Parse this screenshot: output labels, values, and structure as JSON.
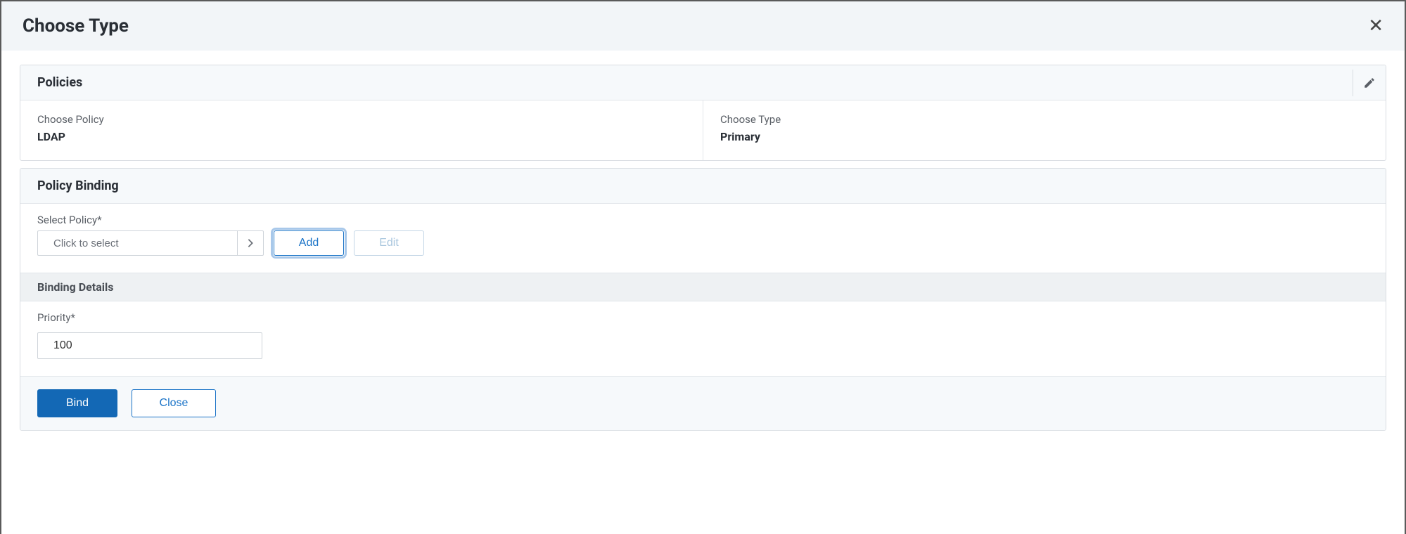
{
  "header": {
    "title": "Choose Type"
  },
  "policies": {
    "section_title": "Policies",
    "choose_policy_label": "Choose Policy",
    "choose_policy_value": "LDAP",
    "choose_type_label": "Choose Type",
    "choose_type_value": "Primary"
  },
  "binding": {
    "section_title": "Policy Binding",
    "select_policy_label": "Select Policy*",
    "select_policy_placeholder": "Click to select",
    "add_label": "Add",
    "edit_label": "Edit",
    "details_title": "Binding Details",
    "priority_label": "Priority*",
    "priority_value": "100"
  },
  "footer": {
    "bind_label": "Bind",
    "close_label": "Close"
  }
}
